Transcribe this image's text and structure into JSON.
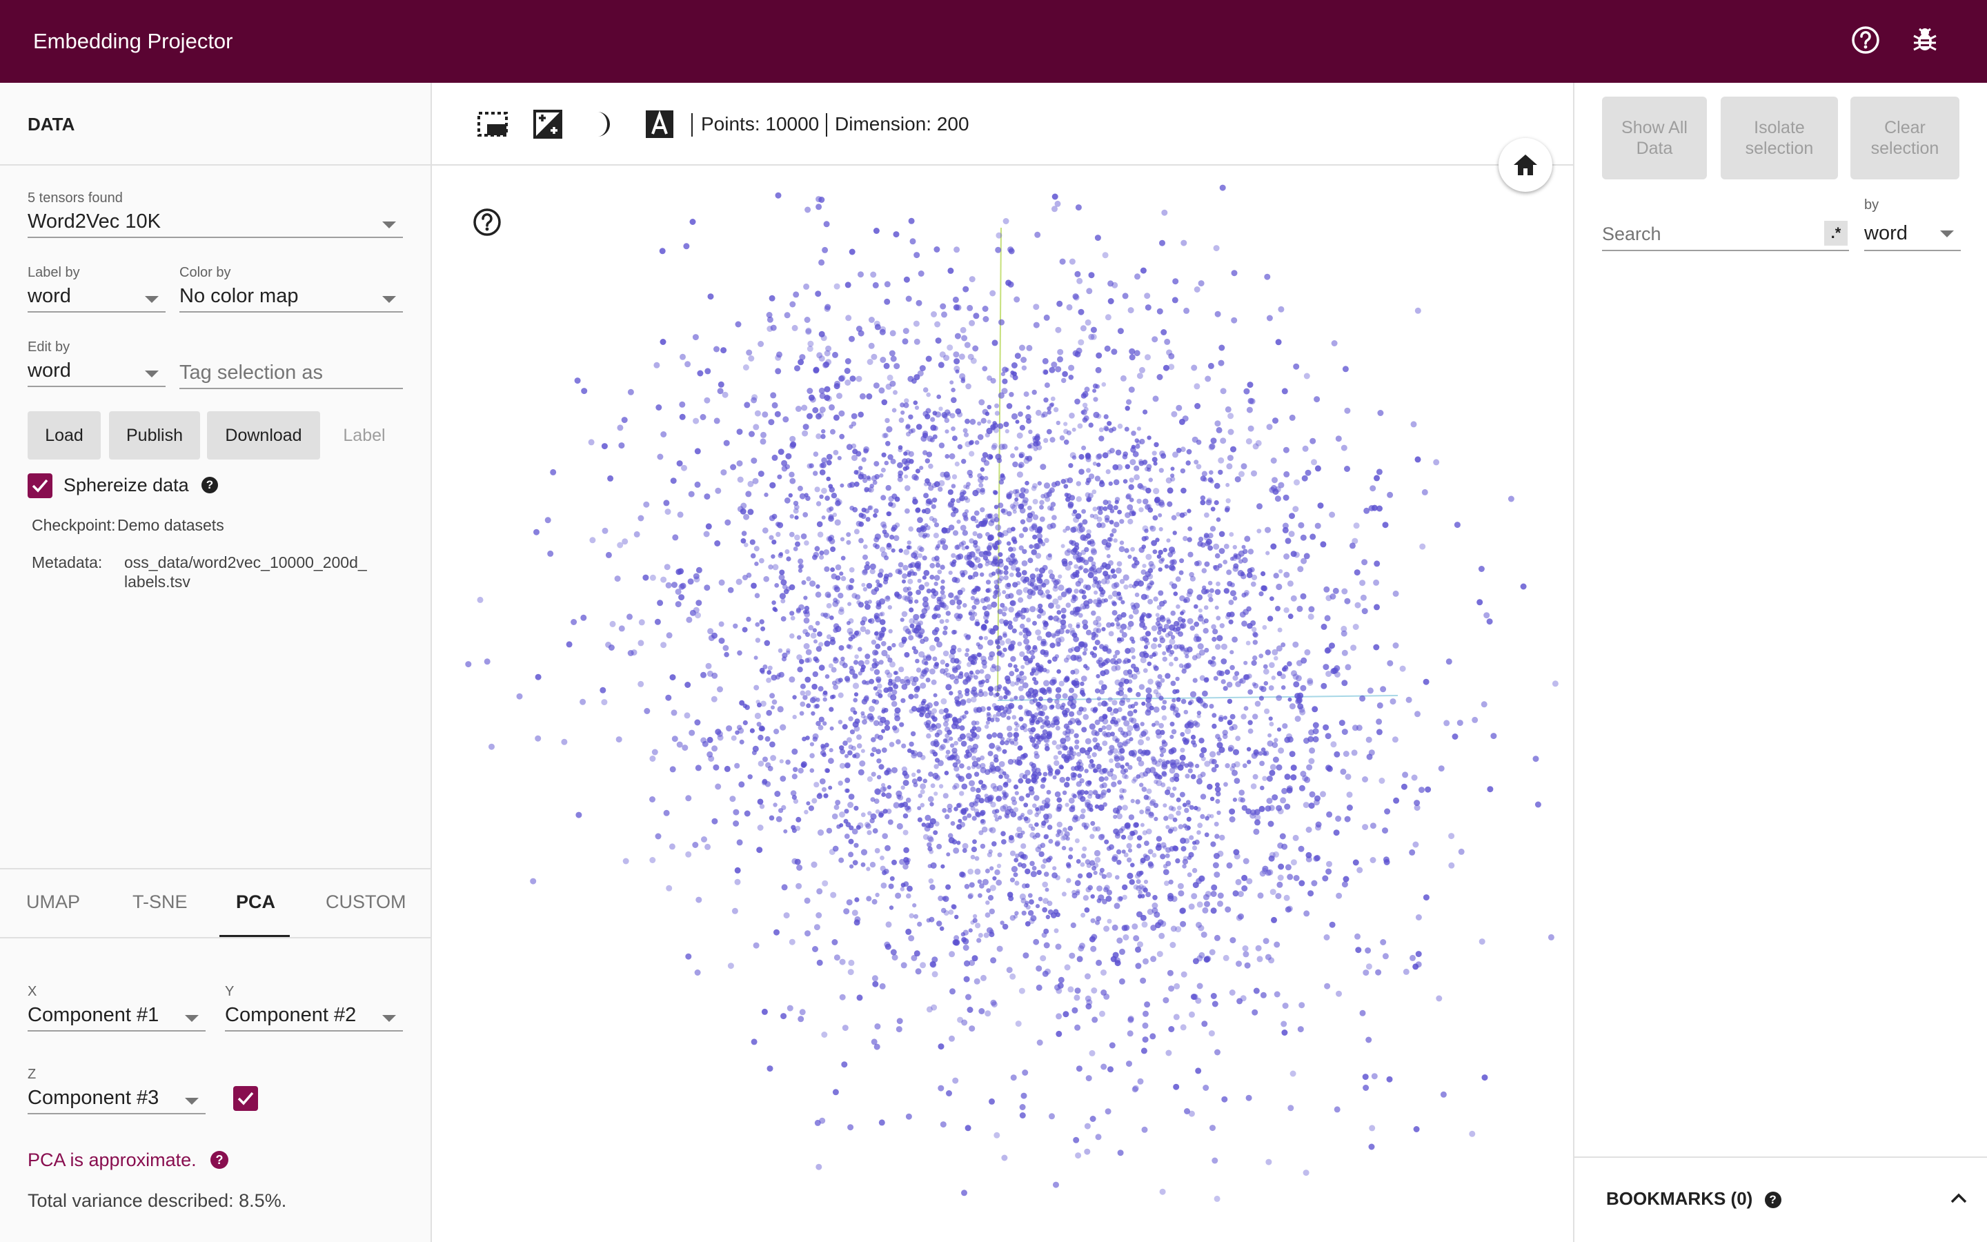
{
  "app": {
    "title": "Embedding Projector"
  },
  "header": {
    "icons": [
      "help-icon",
      "bug-report-icon"
    ]
  },
  "data_panel": {
    "title": "DATA",
    "tensors_label": "5 tensors found",
    "tensor_value": "Word2Vec 10K",
    "label_by_label": "Label by",
    "label_by_value": "word",
    "color_by_label": "Color by",
    "color_by_value": "No color map",
    "edit_by_label": "Edit by",
    "edit_by_value": "word",
    "tag_placeholder": "Tag selection as",
    "buttons": {
      "load": "Load",
      "publish": "Publish",
      "download": "Download",
      "label": "Label"
    },
    "sphereize_label": "Sphereize data",
    "sphereize_checked": true,
    "checkpoint_key": "Checkpoint:",
    "checkpoint_value": "Demo datasets",
    "metadata_key": "Metadata:",
    "metadata_value_line1": "oss_data/word2vec_10000_200d_",
    "metadata_value_line2": "labels.tsv"
  },
  "projection_panel": {
    "tabs": [
      "UMAP",
      "T-SNE",
      "PCA",
      "CUSTOM"
    ],
    "active_tab": "PCA",
    "x_label": "X",
    "x_value": "Component #1",
    "y_label": "Y",
    "y_value": "Component #2",
    "z_label": "Z",
    "z_value": "Component #3",
    "z_enabled": true,
    "pca_warning": "PCA is approximate.",
    "variance_text": "Total variance described: 8.5%."
  },
  "toolbar": {
    "points_text": "Points: 10000",
    "dimension_text": "Dimension: 200"
  },
  "inspector": {
    "show_all_line1": "Show All",
    "show_all_line2": "Data",
    "isolate_line1": "Isolate",
    "isolate_line2": "selection",
    "clear_line1": "Clear",
    "clear_line2": "selection",
    "search_placeholder": "Search",
    "regex_label": ".*",
    "by_label": "by",
    "by_value": "word",
    "bookmarks_label": "BOOKMARKS (0)"
  },
  "colors": {
    "header": "#5a0432",
    "accent": "#880e4f",
    "points": "#5a4fd0"
  }
}
